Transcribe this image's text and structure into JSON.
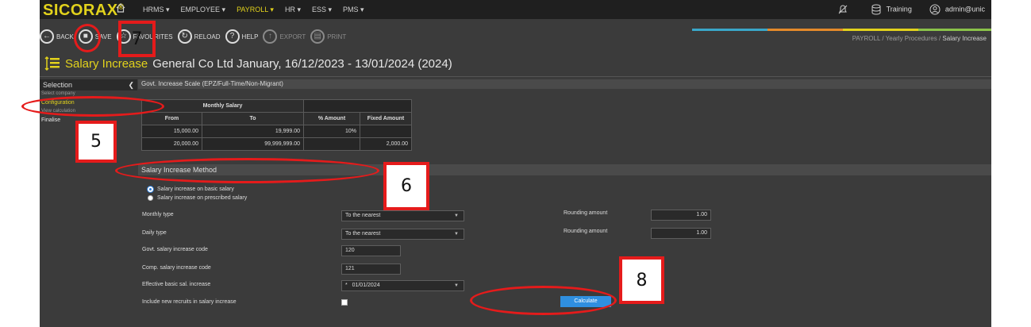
{
  "app": {
    "logo": "SICORAX",
    "logo_mark": "®",
    "nav": [
      "HRMS ▾",
      "EMPLOYEE ▾",
      "PAYROLL ▾",
      "HR ▾",
      "ESS ▾",
      "PMS ▾"
    ],
    "nav_active_index": 2,
    "top_right": {
      "training": "Training",
      "user": "admin@unic"
    }
  },
  "toolbar": {
    "back": "BACK",
    "save": "SAVE",
    "favourites": "FAVOURITES",
    "reload": "RELOAD",
    "help": "HELP",
    "export": "EXPORT",
    "print": "PRINT"
  },
  "breadcrumb": {
    "a": "PAYROLL /",
    "b": "Yearly Procedures /",
    "c": "Salary Increase"
  },
  "title": {
    "main": "Salary Increase",
    "sub": "General Co Ltd  January, 16/12/2023 - 13/01/2024 (2024)"
  },
  "sidebar": {
    "heading": "Selection",
    "items": [
      {
        "label": "Select company",
        "state": "dim"
      },
      {
        "label": "Configuration",
        "state": "active"
      },
      {
        "label": "View calculation",
        "state": "dim"
      },
      {
        "label": "Finalise",
        "state": "normal"
      }
    ]
  },
  "scale_section": {
    "heading": "Govt. Increase Scale (EPZ/Full-Time/Non-Migrant)",
    "group_header": "Monthly Salary",
    "columns": [
      "From",
      "To",
      "% Amount",
      "Fixed Amount"
    ],
    "rows": [
      [
        "15,000.00",
        "19,999.00",
        "10%",
        ""
      ],
      [
        "20,000.00",
        "99,999,999.00",
        "",
        "2,000.00"
      ]
    ]
  },
  "method_section": {
    "heading": "Salary Increase Method",
    "radio_basic": "Salary increase on basic salary",
    "radio_prescribed": "Salary increase on prescribed salary",
    "monthly_type_label": "Monthly type",
    "monthly_type_value": "To the nearest",
    "daily_type_label": "Daily type",
    "daily_type_value": "To the nearest",
    "rounding_label_1": "Rounding amount",
    "rounding_value_1": "1.00",
    "rounding_label_2": "Rounding amount",
    "rounding_value_2": "1.00",
    "govt_code_label": "Govt. salary increase code",
    "govt_code_value": "120",
    "comp_code_label": "Comp. salary increase code",
    "comp_code_value": "121",
    "effective_label": "Effective basic sal. increase",
    "effective_value": "01/01/2024",
    "effective_marker": "*",
    "recruits_label": "Include new recruits in salary increase",
    "calculate": "Calculate"
  },
  "annotations": {
    "n5": "5",
    "n6": "6",
    "n7": "7",
    "n8": "8"
  },
  "colors": {
    "accent_yellow": "#e2d21c",
    "annotation_red": "#e51b1b",
    "button_blue": "#2f8fe0",
    "bar1": "#3aa7c9",
    "bar2": "#e58a2a",
    "bar3": "#e2d21c",
    "bar4": "#8bc34a"
  }
}
